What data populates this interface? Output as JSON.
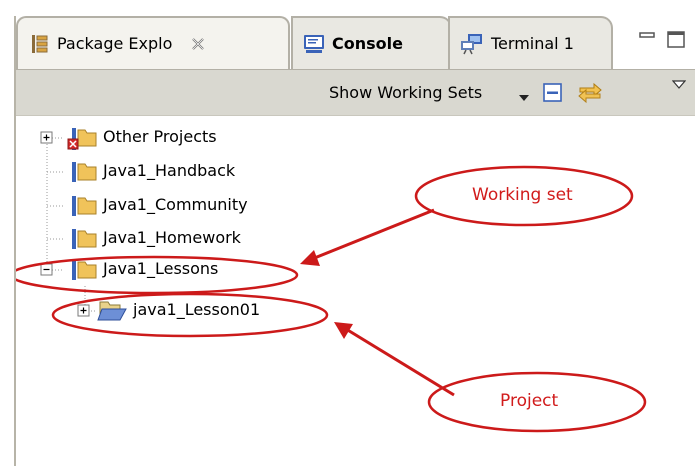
{
  "tabs": {
    "package_explorer": "Package Explo",
    "console": "Console",
    "terminal": "Terminal 1"
  },
  "toolbar": {
    "show_working_sets": "Show Working Sets"
  },
  "tree": {
    "items": [
      {
        "label": "Other Projects",
        "expander": "plus"
      },
      {
        "label": "Java1_Handback"
      },
      {
        "label": "Java1_Community"
      },
      {
        "label": "Java1_Homework"
      },
      {
        "label": "Java1_Lessons",
        "expander": "minus"
      },
      {
        "label": "java1_Lesson01",
        "expander": "plus"
      }
    ]
  },
  "annotations": {
    "working_set": "Working set",
    "project": "Project"
  },
  "colors": {
    "annotation": "#d11b1b",
    "toolbar_bg": "#d9d8d0",
    "folder": "#f0c35a"
  }
}
